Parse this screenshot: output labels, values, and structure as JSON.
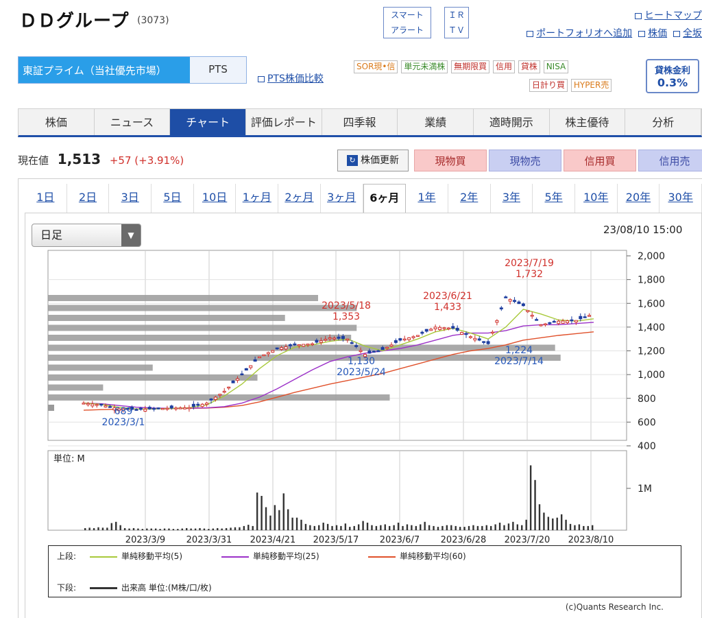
{
  "header": {
    "company_name": "ＤＤグループ",
    "code": "(3073)",
    "smart_alert": [
      "スマート",
      "アラート"
    ],
    "ir_tv": [
      "ＩＲ",
      "ＴＶ"
    ],
    "links": {
      "heatmap": "ヒートマップ",
      "add_portfolio": "ポートフォリオへ追加",
      "stock_price": "株価",
      "all": "全坂"
    }
  },
  "market": {
    "selected": "東証プライム（当社優先市場）",
    "pts": "PTS",
    "pts_compare": "PTS株価比較"
  },
  "badges": {
    "row1": [
      "SOR現•信",
      "単元未満株",
      "無期限買",
      "信用",
      "貸株",
      "NISA"
    ],
    "row2": [
      "日計り買",
      "HYPER売"
    ],
    "colors": {
      "orange": "#d97a1a",
      "green": "#3a8a2a",
      "red": "#c0302b"
    }
  },
  "lending": {
    "label": "貸株金利",
    "value": "0.3%"
  },
  "nav_tabs": [
    "株価",
    "ニュース",
    "チャート",
    "評価レポート",
    "四季報",
    "業績",
    "適時開示",
    "株主優待",
    "分析"
  ],
  "nav_active": 2,
  "price": {
    "label": "現在値",
    "value": "1,513",
    "change": "+57 (+3.91%)"
  },
  "buttons": {
    "refresh": "株価更新",
    "spot_buy": "現物買",
    "spot_sell": "現物売",
    "margin_buy": "信用買",
    "margin_sell": "信用売"
  },
  "period_tabs": [
    "1日",
    "2日",
    "3日",
    "5日",
    "10日",
    "1ヶ月",
    "2ヶ月",
    "3ヶ月",
    "6ヶ月",
    "1年",
    "2年",
    "3年",
    "5年",
    "10年",
    "20年",
    "30年"
  ],
  "period_active": 8,
  "candle_select": "日足",
  "timestamp": "23/08/10 15:00",
  "colors": {
    "accent": "#1e4ea6",
    "ma5": "#a8c93a",
    "ma25": "#9b30c8",
    "ma60": "#e0502a",
    "up": "#d0302b",
    "down": "#1f3fa0"
  },
  "chart_data": [
    {
      "type": "line",
      "subtype": "candlestick",
      "y_ticks": [
        "2,000",
        "1,800",
        "1,600",
        "1,400",
        "1,200",
        "1,000",
        "800",
        "600",
        "400"
      ],
      "ylim": [
        400,
        2000
      ],
      "annotations": [
        {
          "date": "2023/3/1",
          "value": "689",
          "kind": "low"
        },
        {
          "date": "2023/5/18",
          "value": "1,353",
          "kind": "high"
        },
        {
          "date": "2023/5/24",
          "value": "1,130",
          "kind": "low"
        },
        {
          "date": "2023/6/21",
          "value": "1,433",
          "kind": "high"
        },
        {
          "date": "2023/7/14",
          "value": "1,224",
          "kind": "low"
        },
        {
          "date": "2023/7/19",
          "value": "1,732",
          "kind": "high"
        }
      ],
      "close_series": [
        [
          "2023/2/13",
          760
        ],
        [
          "2023/2/20",
          745
        ],
        [
          "2023/2/27",
          712
        ],
        [
          "2023/3/6",
          705
        ],
        [
          "2023/3/13",
          712
        ],
        [
          "2023/3/20",
          718
        ],
        [
          "2023/3/27",
          722
        ],
        [
          "2023/4/3",
          760
        ],
        [
          "2023/4/10",
          860
        ],
        [
          "2023/4/14",
          1000
        ],
        [
          "2023/4/19",
          1150
        ],
        [
          "2023/4/24",
          1220
        ],
        [
          "2023/5/1",
          1250
        ],
        [
          "2023/5/8",
          1260
        ],
        [
          "2023/5/15",
          1310
        ],
        [
          "2023/5/18",
          1300
        ],
        [
          "2023/5/24",
          1170
        ],
        [
          "2023/5/31",
          1210
        ],
        [
          "2023/6/7",
          1290
        ],
        [
          "2023/6/14",
          1330
        ],
        [
          "2023/6/21",
          1400
        ],
        [
          "2023/6/28",
          1390
        ],
        [
          "2023/7/5",
          1320
        ],
        [
          "2023/7/14",
          1260
        ],
        [
          "2023/7/19",
          1650
        ],
        [
          "2023/7/24",
          1580
        ],
        [
          "2023/7/28",
          1420
        ],
        [
          "2023/8/3",
          1450
        ],
        [
          "2023/8/8",
          1456
        ],
        [
          "2023/8/10",
          1513
        ]
      ],
      "ma5": [
        760,
        750,
        725,
        710,
        710,
        715,
        720,
        745,
        820,
        920,
        1050,
        1160,
        1230,
        1250,
        1280,
        1300,
        1240,
        1200,
        1250,
        1300,
        1360,
        1390,
        1350,
        1300,
        1400,
        1550,
        1510,
        1460,
        1450,
        1470
      ],
      "ma25": [
        760,
        755,
        740,
        725,
        718,
        716,
        718,
        720,
        730,
        760,
        810,
        880,
        960,
        1040,
        1110,
        1150,
        1180,
        1200,
        1220,
        1250,
        1290,
        1330,
        1350,
        1350,
        1370,
        1410,
        1420,
        1420,
        1430,
        1440
      ],
      "ma60": [
        700,
        705,
        708,
        710,
        712,
        714,
        716,
        718,
        725,
        740,
        770,
        810,
        850,
        885,
        920,
        950,
        980,
        1010,
        1050,
        1090,
        1130,
        1170,
        1200,
        1220,
        1250,
        1290,
        1310,
        1330,
        1345,
        1360
      ],
      "volume_profile_widths": [
        0.49,
        0.56,
        0.43,
        0.56,
        0.55,
        0.92,
        0.93,
        0.19,
        0.38,
        0.1,
        0.62
      ]
    },
    {
      "type": "bar",
      "title": "単位: M",
      "y_ticks": [
        "1M"
      ],
      "x_labels": [
        "2023/3/9",
        "2023/3/31",
        "2023/4/21",
        "2023/5/17",
        "2023/6/7",
        "2023/6/28",
        "2023/7/20",
        "2023/8/10"
      ],
      "volumes": [
        0.05,
        0.06,
        0.05,
        0.07,
        0.06,
        0.06,
        0.17,
        0.2,
        0.12,
        0.05,
        0.04,
        0.05,
        0.04,
        0.03,
        0.04,
        0.04,
        0.04,
        0.03,
        0.04,
        0.04,
        0.03,
        0.03,
        0.04,
        0.05,
        0.04,
        0.04,
        0.05,
        0.04,
        0.03,
        0.04,
        0.05,
        0.04,
        0.05,
        0.06,
        0.07,
        0.07,
        0.1,
        0.13,
        0.1,
        0.9,
        0.82,
        0.55,
        0.35,
        0.6,
        0.48,
        0.88,
        0.5,
        0.3,
        0.3,
        0.25,
        0.15,
        0.12,
        0.1,
        0.12,
        0.18,
        0.15,
        0.1,
        0.12,
        0.1,
        0.16,
        0.08,
        0.1,
        0.14,
        0.22,
        0.18,
        0.12,
        0.1,
        0.12,
        0.14,
        0.1,
        0.12,
        0.18,
        0.1,
        0.14,
        0.12,
        0.1,
        0.14,
        0.2,
        0.12,
        0.1,
        0.08,
        0.1,
        0.12,
        0.12,
        0.1,
        0.08,
        0.08,
        0.1,
        0.12,
        0.1,
        0.1,
        0.12,
        0.1,
        0.14,
        0.18,
        0.12,
        0.16,
        0.2,
        0.14,
        0.12,
        0.25,
        1.55,
        1.2,
        0.62,
        0.42,
        0.32,
        0.28,
        0.3,
        0.38,
        0.25,
        0.15,
        0.12,
        0.14,
        0.1,
        0.1,
        0.12
      ]
    }
  ],
  "legend": {
    "upper_label": "上段:",
    "ma5": "単純移動平均(5)",
    "ma25": "単純移動平均(25)",
    "ma60": "単純移動平均(60)",
    "lower_label": "下段:",
    "volume": "出来高 単位:(M株/口/枚)"
  },
  "copyright": "(c)Quants Research Inc."
}
